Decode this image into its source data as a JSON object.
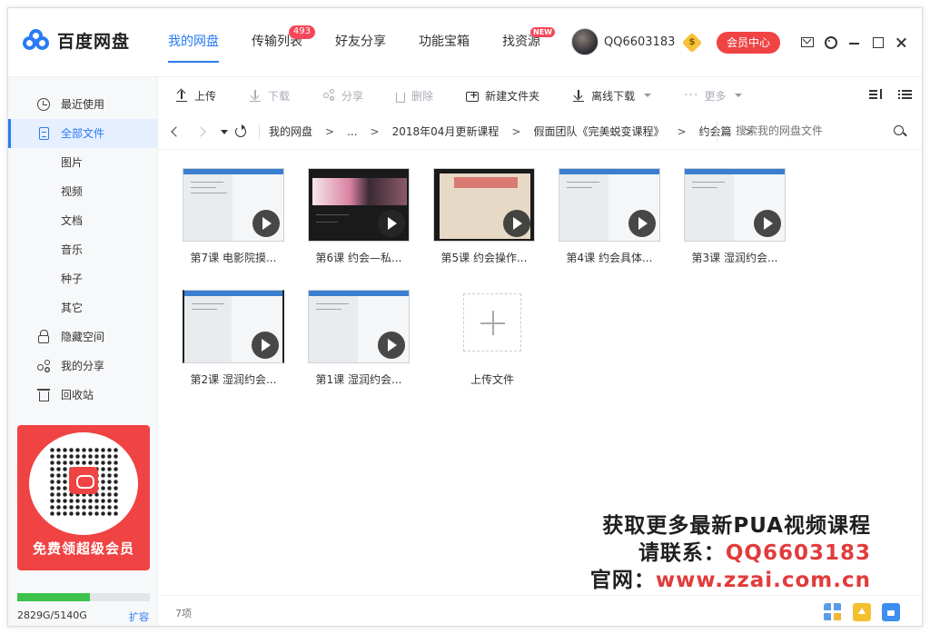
{
  "app": {
    "name": "百度网盘"
  },
  "nav": [
    {
      "label": "我的网盘",
      "active": true
    },
    {
      "label": "传输列表",
      "badge": "493"
    },
    {
      "label": "好友分享"
    },
    {
      "label": "功能宝箱"
    },
    {
      "label": "找资源",
      "badge": "NEW"
    }
  ],
  "user": {
    "name": "QQ6603183",
    "vip_badge": "$",
    "member_btn": "会员中心"
  },
  "sidebar": {
    "items": [
      {
        "label": "最近使用",
        "icon": "clock-icon"
      },
      {
        "label": "全部文件",
        "icon": "file-icon",
        "active": true
      },
      {
        "label": "图片",
        "sub": true
      },
      {
        "label": "视频",
        "sub": true
      },
      {
        "label": "文档",
        "sub": true
      },
      {
        "label": "音乐",
        "sub": true
      },
      {
        "label": "种子",
        "sub": true
      },
      {
        "label": "其它",
        "sub": true
      },
      {
        "label": "隐藏空间",
        "icon": "lock-icon"
      },
      {
        "label": "我的分享",
        "icon": "share-icon"
      },
      {
        "label": "回收站",
        "icon": "trash-icon"
      }
    ],
    "promo_text": "免费领超级会员",
    "storage": {
      "text": "2829G/5140G",
      "used_fraction": 0.55,
      "expand_label": "扩容"
    }
  },
  "toolbar": {
    "upload": "上传",
    "download": "下载",
    "share": "分享",
    "delete": "删除",
    "new_folder": "新建文件夹",
    "offline_download": "离线下载",
    "more": "更多"
  },
  "path": {
    "crumbs": [
      "我的网盘",
      "...",
      "2018年04月更新课程",
      "假面团队《完美蜕变课程》",
      "约会篇"
    ],
    "separator": ">",
    "search_placeholder": "搜索我的网盘文件"
  },
  "files": [
    {
      "name": "第7课 电影院摸...",
      "thumb": "screen"
    },
    {
      "name": "第6课 约会—私...",
      "thumb": "dark"
    },
    {
      "name": "第5课 约会操作...",
      "thumb": "paper"
    },
    {
      "name": "第4课 约会具体...",
      "thumb": "screen"
    },
    {
      "name": "第3课 湿润约会...",
      "thumb": "screen"
    },
    {
      "name": "第2课 湿润约会...",
      "thumb": "screen"
    },
    {
      "name": "第1课 湿润约会...",
      "thumb": "screen"
    }
  ],
  "upload_tile": {
    "label": "上传文件"
  },
  "watermark": {
    "line1": "获取更多最新PUA视频课程",
    "line2_prefix": "请联系：",
    "line2_value": "QQ6603183",
    "line3_prefix": "官网：",
    "line3_value": "www.zzai.com.cn"
  },
  "status": {
    "count": "7项"
  }
}
